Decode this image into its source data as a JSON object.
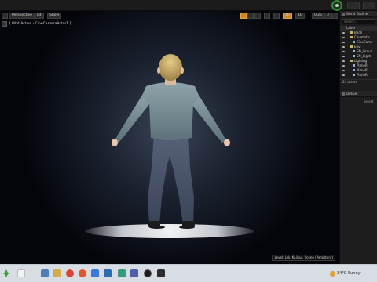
{
  "toolbar": {
    "perspective_label": "Perspective",
    "lit_label": "Lit",
    "show_label": "Show",
    "camera_speed_value": "3",
    "fov_value": "0.25",
    "grid_value": "10",
    "rot_value": "10"
  },
  "viewport": {
    "pilot_text": "[ Pilot Active - CineCameraActor1 ]",
    "level_label": "Level: Lek_Kailkus_Scene (Persistent)"
  },
  "world_outliner": {
    "title": "World Outliner",
    "search_placeholder": "Search...",
    "column_label": "Label",
    "items": [
      {
        "label": "Body",
        "type": "folder",
        "indent": 0
      },
      {
        "label": "Cinematic",
        "type": "folder",
        "indent": 0
      },
      {
        "label": "CineCame",
        "type": "actor",
        "indent": 1
      },
      {
        "label": "Env",
        "type": "folder",
        "indent": 0
      },
      {
        "label": "SM_Groun",
        "type": "actor",
        "indent": 1
      },
      {
        "label": "SM_Light",
        "type": "actor",
        "indent": 1
      },
      {
        "label": "Lighting",
        "type": "folder",
        "indent": 0
      },
      {
        "label": "PlaneR",
        "type": "actor",
        "indent": 1
      },
      {
        "label": "PlaneR",
        "type": "actor",
        "indent": 1
      },
      {
        "label": "PlaneR",
        "type": "actor",
        "indent": 1
      }
    ],
    "actors_count": "24 actors"
  },
  "details": {
    "title": "Details",
    "select_hint": "Select"
  },
  "taskbar": {
    "weather_text": "34°C Sunny"
  },
  "colors": {
    "accent_orange": "#e8a13d",
    "play_green": "#2e8d2e",
    "folder_yellow": "#c9b46a"
  }
}
